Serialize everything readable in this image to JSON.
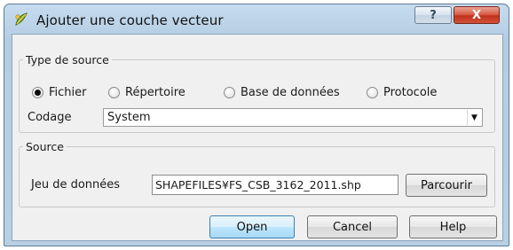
{
  "window": {
    "title": "Ajouter une couche vecteur",
    "help_label": "?",
    "close_label": "X"
  },
  "source_type": {
    "legend": "Type de source",
    "options": [
      {
        "label": "Fichier",
        "selected": true
      },
      {
        "label": "Répertoire",
        "selected": false
      },
      {
        "label": "Base de données",
        "selected": false
      },
      {
        "label": "Protocole",
        "selected": false
      }
    ],
    "encoding_label": "Codage",
    "encoding_value": "System"
  },
  "source": {
    "legend": "Source",
    "dataset_label": "Jeu de données",
    "dataset_value": "SHAPEFILES¥FS_CSB_3162_2011.shp",
    "browse_label": "Parcourir"
  },
  "buttons": {
    "open": "Open",
    "cancel": "Cancel",
    "help": "Help"
  },
  "icons": {
    "app": "qgis-icon",
    "help": "question-icon",
    "close": "close-icon",
    "dropdown": "chevron-down-icon"
  },
  "colors": {
    "titlebar": "#b4cde3",
    "close_button": "#c2311c",
    "default_button": "#bee6fd",
    "client_bg": "#f0f0f0"
  }
}
